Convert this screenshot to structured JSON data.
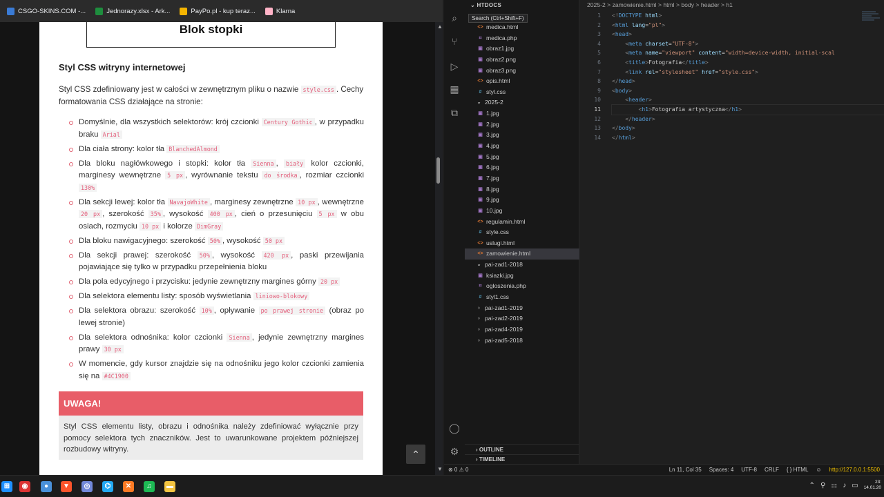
{
  "bookmarks": [
    {
      "label": "CSGO-SKINS.COM -...",
      "icon": "csgo-icon",
      "color": "#3a7bd5"
    },
    {
      "label": "Jednorazy.xlsx - Ark...",
      "icon": "sheets-icon",
      "color": "#1e8e3e"
    },
    {
      "label": "PayPo.pl - kup teraz...",
      "icon": "paypo-icon",
      "color": "#f4b400"
    },
    {
      "label": "Klarna",
      "icon": "klarna-icon",
      "color": "#ffb3c7"
    }
  ],
  "page": {
    "footer_block": "Blok stopki",
    "section_title": "Styl CSS witryny internetowej",
    "intro_a": "Styl CSS zdefiniowany jest w całości w zewnętrznym pliku o nazwie ",
    "intro_code": "style.css",
    "intro_b": ". Cechy formatowania CSS działające na stronie:",
    "rules": [
      {
        "parts": [
          [
            "t",
            "Domyślnie, dla wszystkich selektorów: krój czcionki "
          ],
          [
            "c",
            "Century Gothic"
          ],
          [
            "t",
            ", w przypadku braku "
          ],
          [
            "c",
            "Arial"
          ]
        ]
      },
      {
        "parts": [
          [
            "t",
            "Dla ciała strony: kolor tła "
          ],
          [
            "c",
            "BlanchedAlmond"
          ]
        ]
      },
      {
        "parts": [
          [
            "t",
            "Dla bloku nagłówkowego i stopki: kolor tła "
          ],
          [
            "c",
            "Sienna"
          ],
          [
            "t",
            ", "
          ],
          [
            "c",
            "biały"
          ],
          [
            "t",
            " kolor czcionki, marginesy wewnętrzne "
          ],
          [
            "c",
            "5 px"
          ],
          [
            "t",
            ", wyrównanie tekstu "
          ],
          [
            "c",
            "do środka"
          ],
          [
            "t",
            ", rozmiar czcionki "
          ],
          [
            "c",
            "130%"
          ]
        ]
      },
      {
        "parts": [
          [
            "t",
            "Dla sekcji lewej: kolor tła "
          ],
          [
            "c",
            "NavajoWhite"
          ],
          [
            "t",
            ", marginesy zewnętrzne "
          ],
          [
            "c",
            "10 px"
          ],
          [
            "t",
            ", wewnętrzne "
          ],
          [
            "c",
            "20 px"
          ],
          [
            "t",
            ", szerokość "
          ],
          [
            "c",
            "35%"
          ],
          [
            "t",
            ", wysokość "
          ],
          [
            "c",
            "400 px"
          ],
          [
            "t",
            ", cień o przesunięciu "
          ],
          [
            "c",
            "5 px"
          ],
          [
            "t",
            " w obu osiach, rozmyciu "
          ],
          [
            "c",
            "10 px"
          ],
          [
            "t",
            " i kolorze "
          ],
          [
            "c",
            "DimGray"
          ]
        ]
      },
      {
        "parts": [
          [
            "t",
            "Dla bloku nawigacyjnego: szerokość "
          ],
          [
            "c",
            "50%"
          ],
          [
            "t",
            ", wysokość "
          ],
          [
            "c",
            "50 px"
          ]
        ]
      },
      {
        "parts": [
          [
            "t",
            "Dla sekcji prawej: szerokość "
          ],
          [
            "c",
            "50%"
          ],
          [
            "t",
            ", wysokość "
          ],
          [
            "c",
            "420 px"
          ],
          [
            "t",
            ", paski przewijania pojawiające się tylko w przypadku przepełnienia bloku"
          ]
        ]
      },
      {
        "parts": [
          [
            "t",
            "Dla pola edycyjnego i przycisku: jedynie zewnętrzny margines górny "
          ],
          [
            "c",
            "20 px"
          ]
        ]
      },
      {
        "parts": [
          [
            "t",
            "Dla selektora elementu listy: sposób wyświetlania "
          ],
          [
            "c",
            "liniowo-blokowy"
          ]
        ]
      },
      {
        "parts": [
          [
            "t",
            "Dla selektora obrazu: szerokość "
          ],
          [
            "c",
            "10%"
          ],
          [
            "t",
            ", opływanie "
          ],
          [
            "c",
            "po prawej stronie"
          ],
          [
            "t",
            " (obraz po lewej stronie)"
          ]
        ]
      },
      {
        "parts": [
          [
            "t",
            "Dla selektora odnośnika: kolor czcionki "
          ],
          [
            "c",
            "Sienna"
          ],
          [
            "t",
            ", jedynie zewnętrzny margines prawy "
          ],
          [
            "c",
            "30 px"
          ]
        ]
      },
      {
        "parts": [
          [
            "t",
            "W momencie, gdy kursor znajdzie się na odnośniku jego kolor czcionki zamienia się na "
          ],
          [
            "c",
            "#4C1900"
          ]
        ]
      }
    ],
    "warning_title": "UWAGA!",
    "warning_body": "Styl CSS elementu listy, obrazu i odnośnika należy zdefiniować wyłącznie przy pomocy selektora tych znaczników. Jest to uwarunkowane projektem późniejszej rozbudowy witryny."
  },
  "vscode": {
    "explorer_title": "HTDOCS",
    "search_tooltip": "Search (Ctrl+Shift+F)",
    "tree": [
      {
        "label": "medica.html",
        "indent": 1,
        "kind": "html"
      },
      {
        "label": "medica.php",
        "indent": 1,
        "kind": "php"
      },
      {
        "label": "obraz1.jpg",
        "indent": 1,
        "kind": "img"
      },
      {
        "label": "obraz2.png",
        "indent": 1,
        "kind": "img"
      },
      {
        "label": "obraz3.png",
        "indent": 1,
        "kind": "img"
      },
      {
        "label": "opis.html",
        "indent": 1,
        "kind": "html"
      },
      {
        "label": "styl.css",
        "indent": 1,
        "kind": "css"
      },
      {
        "label": "2025-2",
        "indent": 0,
        "kind": "folder-open"
      },
      {
        "label": "1.jpg",
        "indent": 1,
        "kind": "img"
      },
      {
        "label": "2.jpg",
        "indent": 1,
        "kind": "img"
      },
      {
        "label": "3.jpg",
        "indent": 1,
        "kind": "img"
      },
      {
        "label": "4.jpg",
        "indent": 1,
        "kind": "img"
      },
      {
        "label": "5.jpg",
        "indent": 1,
        "kind": "img"
      },
      {
        "label": "6.jpg",
        "indent": 1,
        "kind": "img"
      },
      {
        "label": "7.jpg",
        "indent": 1,
        "kind": "img"
      },
      {
        "label": "8.jpg",
        "indent": 1,
        "kind": "img"
      },
      {
        "label": "9.jpg",
        "indent": 1,
        "kind": "img"
      },
      {
        "label": "10.jpg",
        "indent": 1,
        "kind": "img"
      },
      {
        "label": "regulamin.html",
        "indent": 1,
        "kind": "html"
      },
      {
        "label": "style.css",
        "indent": 1,
        "kind": "css"
      },
      {
        "label": "uslugi.html",
        "indent": 1,
        "kind": "html"
      },
      {
        "label": "zamowienie.html",
        "indent": 1,
        "kind": "html",
        "selected": true
      },
      {
        "label": "pai-zad1-2018",
        "indent": 0,
        "kind": "folder-open"
      },
      {
        "label": "ksiazki.jpg",
        "indent": 1,
        "kind": "img"
      },
      {
        "label": "ogloszenia.php",
        "indent": 1,
        "kind": "php"
      },
      {
        "label": "styl1.css",
        "indent": 1,
        "kind": "css"
      },
      {
        "label": "pai-zad1-2019",
        "indent": 0,
        "kind": "folder"
      },
      {
        "label": "pai-zad2-2019",
        "indent": 0,
        "kind": "folder"
      },
      {
        "label": "pai-zad4-2019",
        "indent": 0,
        "kind": "folder"
      },
      {
        "label": "pai-zad5-2018",
        "indent": 0,
        "kind": "folder"
      }
    ],
    "outline_label": "OUTLINE",
    "timeline_label": "TIMELINE",
    "breadcrumb": [
      "2025-2",
      "zamowienie.html",
      "html",
      "body",
      "header",
      "h1"
    ],
    "current_line": 11,
    "code_lines": [
      [
        [
          "punct",
          "<!"
        ],
        [
          "tag",
          "DOCTYPE"
        ],
        [
          "attr",
          " html"
        ],
        [
          "punct",
          ">"
        ]
      ],
      [
        [
          "punct",
          "<"
        ],
        [
          "tag",
          "html"
        ],
        [
          "attr",
          " lang"
        ],
        [
          "txt",
          "="
        ],
        [
          "str",
          "\"pl\""
        ],
        [
          "punct",
          ">"
        ]
      ],
      [
        [
          "punct",
          "<"
        ],
        [
          "tag",
          "head"
        ],
        [
          "punct",
          ">"
        ]
      ],
      [
        [
          "txt",
          "    "
        ],
        [
          "punct",
          "<"
        ],
        [
          "tag",
          "meta"
        ],
        [
          "attr",
          " charset"
        ],
        [
          "txt",
          "="
        ],
        [
          "str",
          "\"UTF-8\""
        ],
        [
          "punct",
          ">"
        ]
      ],
      [
        [
          "txt",
          "    "
        ],
        [
          "punct",
          "<"
        ],
        [
          "tag",
          "meta"
        ],
        [
          "attr",
          " name"
        ],
        [
          "txt",
          "="
        ],
        [
          "str",
          "\"viewport\""
        ],
        [
          "attr",
          " content"
        ],
        [
          "txt",
          "="
        ],
        [
          "str",
          "\"width=device-width, initial-scal"
        ]
      ],
      [
        [
          "txt",
          "    "
        ],
        [
          "punct",
          "<"
        ],
        [
          "tag",
          "title"
        ],
        [
          "punct",
          ">"
        ],
        [
          "txt",
          "Fotografia"
        ],
        [
          "punct",
          "</"
        ],
        [
          "tag",
          "title"
        ],
        [
          "punct",
          ">"
        ]
      ],
      [
        [
          "txt",
          "    "
        ],
        [
          "punct",
          "<"
        ],
        [
          "tag",
          "link"
        ],
        [
          "attr",
          " rel"
        ],
        [
          "txt",
          "="
        ],
        [
          "str",
          "\"stylesheet\""
        ],
        [
          "attr",
          " href"
        ],
        [
          "txt",
          "="
        ],
        [
          "str",
          "\"style.css\""
        ],
        [
          "punct",
          ">"
        ]
      ],
      [
        [
          "punct",
          "</"
        ],
        [
          "tag",
          "head"
        ],
        [
          "punct",
          ">"
        ]
      ],
      [
        [
          "punct",
          "<"
        ],
        [
          "tag",
          "body"
        ],
        [
          "punct",
          ">"
        ]
      ],
      [
        [
          "txt",
          "    "
        ],
        [
          "punct",
          "<"
        ],
        [
          "tag",
          "header"
        ],
        [
          "punct",
          ">"
        ]
      ],
      [
        [
          "txt",
          "        "
        ],
        [
          "punct",
          "<"
        ],
        [
          "tag",
          "h1"
        ],
        [
          "punct",
          ">"
        ],
        [
          "txt",
          "Fotografia artystyczna"
        ],
        [
          "punct",
          "</"
        ],
        [
          "tag",
          "h1"
        ],
        [
          "punct",
          ">"
        ]
      ],
      [
        [
          "txt",
          "    "
        ],
        [
          "punct",
          "</"
        ],
        [
          "tag",
          "header"
        ],
        [
          "punct",
          ">"
        ]
      ],
      [
        [
          "punct",
          "</"
        ],
        [
          "tag",
          "body"
        ],
        [
          "punct",
          ">"
        ]
      ],
      [
        [
          "punct",
          "</"
        ],
        [
          "tag",
          "html"
        ],
        [
          "punct",
          ">"
        ]
      ]
    ],
    "status": {
      "errors": "⊗ 0 ⚠ 0",
      "position": "Ln 11, Col 35",
      "spaces": "Spaces: 4",
      "encoding": "UTF-8",
      "eol": "CRLF",
      "language": "{ } HTML",
      "live_server": "http://127.0.0.1:5500"
    }
  },
  "taskbar": {
    "apps": [
      {
        "name": "start-icon",
        "color": "#1e90ff",
        "glyph": "⊞"
      },
      {
        "name": "chrome-icon",
        "color": "#d33",
        "glyph": "◉"
      },
      {
        "name": "app-blue-icon",
        "color": "#4a90d9",
        "glyph": "●"
      },
      {
        "name": "brave-icon",
        "color": "#fb542b",
        "glyph": "▼"
      },
      {
        "name": "discord-icon",
        "color": "#7289da",
        "glyph": "◎"
      },
      {
        "name": "vscode-icon",
        "color": "#23a9f2",
        "glyph": "⌬"
      },
      {
        "name": "xampp-icon",
        "color": "#fb7a24",
        "glyph": "✕"
      },
      {
        "name": "spotify-icon",
        "color": "#1db954",
        "glyph": "♫"
      },
      {
        "name": "explorer-icon",
        "color": "#f4c542",
        "glyph": "▬"
      }
    ],
    "clock_time": "23:",
    "clock_date": "14.01.20"
  }
}
